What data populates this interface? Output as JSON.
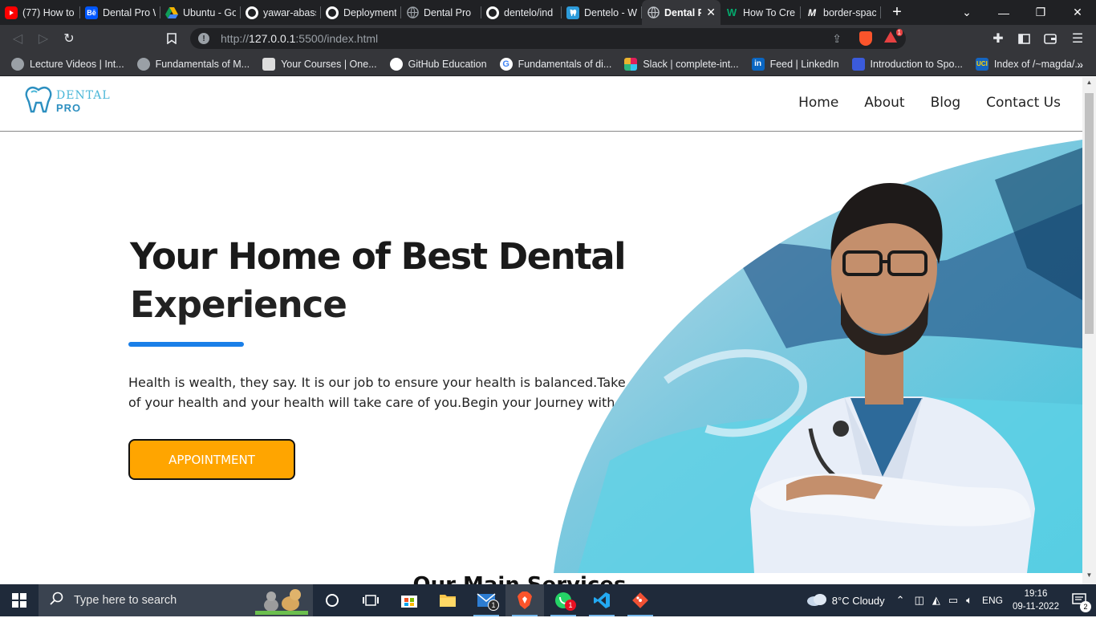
{
  "browser": {
    "tabs": [
      {
        "label": "(77) How to",
        "icon": "youtube-icon",
        "color": "#ff0000"
      },
      {
        "label": "Dental Pro W",
        "icon": "behance-icon",
        "color": "#0057ff"
      },
      {
        "label": "Ubuntu - Go",
        "icon": "drive-icon",
        "color": "#f4b400"
      },
      {
        "label": "yawar-abass",
        "icon": "github-icon",
        "color": "#ffffff"
      },
      {
        "label": "Deployment",
        "icon": "github-icon",
        "color": "#ffffff"
      },
      {
        "label": "Dental Pro",
        "icon": "globe-icon",
        "color": "#9aa0a6"
      },
      {
        "label": "dentelo/ind",
        "icon": "github-icon",
        "color": "#ffffff"
      },
      {
        "label": "Dentelo - W",
        "icon": "tooth-icon",
        "color": "#2d9cdb"
      },
      {
        "label": "Dental P",
        "icon": "globe-icon",
        "color": "#9aa0a6",
        "active": true
      },
      {
        "label": "How To Cre",
        "icon": "w-icon",
        "color": "#04aa6d"
      },
      {
        "label": "border-spac",
        "icon": "medium-icon",
        "color": "#ffffff"
      }
    ],
    "address": {
      "prefix": "http://",
      "host": "127.0.0.1",
      "rest": ":5500/index.html"
    },
    "bookmarks": [
      {
        "label": "Lecture Videos | Int...",
        "color": "#9aa0a6"
      },
      {
        "label": "Fundamentals of M...",
        "color": "#9aa0a6"
      },
      {
        "label": "Your Courses | One...",
        "color": "#dddddd"
      },
      {
        "label": "GitHub Education",
        "color": "#ffffff"
      },
      {
        "label": "Fundamentals of di...",
        "color": "#4285f4"
      },
      {
        "label": "Slack | complete-int...",
        "color": "#e01e5a"
      },
      {
        "label": "Feed | LinkedIn",
        "color": "#0a66c2"
      },
      {
        "label": "Introduction to Spo...",
        "color": "#3b5bdb"
      },
      {
        "label": "Index of /~magda/...",
        "color": "#1565c0"
      }
    ],
    "brave_badge": "1"
  },
  "site": {
    "logo_line1": "DENTAL",
    "logo_line2": "PRO",
    "nav": [
      "Home",
      "About",
      "Blog",
      "Contact Us"
    ],
    "hero_title_bold": "Your Home of Best Dental",
    "hero_title_light": "Experience",
    "hero_text": "Health is wealth, they say. It is our job to ensure your health is balanced.Take care of your health and your health will take care of you.Begin your Journey with Us.",
    "cta": "APPOINTMENT",
    "services_heading": "Our Main Services",
    "colors": {
      "accent_blue": "#1a7fe8",
      "button": "#ffa500",
      "logo": "#4ab7d8"
    }
  },
  "taskbar": {
    "search_placeholder": "Type here to search",
    "apps": [
      "task-view",
      "microsoft-store",
      "file-explorer",
      "mail",
      "brave",
      "whatsapp",
      "vs-code",
      "git"
    ],
    "mail_badge": "1",
    "whatsapp_badge": "1",
    "weather": "8°C  Cloudy",
    "language": "ENG",
    "time": "19:16",
    "date": "09-11-2022",
    "notifications": "2"
  }
}
